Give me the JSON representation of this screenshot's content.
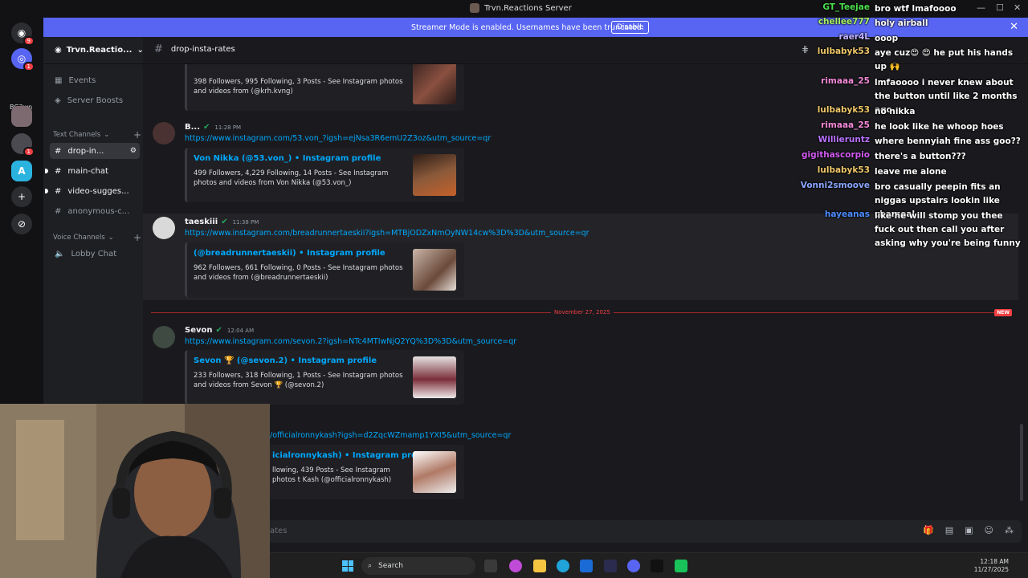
{
  "window": {
    "title": "Trvn.Reactions Server",
    "controls": [
      "—",
      "☐",
      "✕"
    ]
  },
  "banner": {
    "message": "Streamer Mode is enabled. Usernames have been truncated.",
    "disable_label": "Disable"
  },
  "rail": {
    "label": "BG3wn",
    "badges": [
      "9",
      "1",
      "1"
    ]
  },
  "guild": {
    "name": "Trvn.Reactio..."
  },
  "sidebar": {
    "events": "Events",
    "boosts": "Server Boosts",
    "text_cat": "Text Channels",
    "voice_cat": "Voice Channels",
    "channels": [
      "drop-in...",
      "main-chat",
      "video-sugges...",
      "anonymous-c..."
    ],
    "voice": [
      "Lobby Chat"
    ]
  },
  "channel": {
    "name": "drop-insta-rates"
  },
  "messages": [
    {
      "desc": "398 Followers, 995 Following, 3 Posts - See Instagram photos and videos from (@krh.kvng)"
    },
    {
      "user": "B...",
      "time": "11:28 PM",
      "link": "https://www.instagram.com/53.von_?igsh=ejNsa3R6emU2Z3oz&utm_source=qr",
      "title": "Von Nikka (@53.von_) • Instagram profile",
      "desc": "499 Followers, 4,229 Following, 14 Posts - See Instagram photos and videos from Von Nikka (@53.von_)"
    },
    {
      "user": "taeskiii",
      "time": "11:38 PM",
      "link": "https://www.instagram.com/breadrunnertaeskii?igsh=MTBjODZxNmOyNW14cw%3D%3D&utm_source=qr",
      "title": "(@breadrunnertaeskii) • Instagram profile",
      "desc": "962 Followers, 661 Following, 0 Posts - See Instagram photos and videos from (@breadrunnertaeskii)"
    },
    {
      "user": "Sevon",
      "time": "12:04 AM",
      "link": "https://www.instagram.com/sevon.2?igsh=NTc4MTIwNjQ2YQ%3D%3D&utm_source=qr",
      "title": "Sevon 🏆 (@sevon.2) • Instagram profile",
      "desc": "233 Followers, 318 Following, 1 Posts - See Instagram photos and videos from Sevon 🏆 (@sevon.2)"
    },
    {
      "link": "/officialronnykash?igsh=d2ZqcWZmamp1YXI5&utm_source=qr",
      "title": "icialronnykash) • Instagram profile",
      "desc": "llowing, 439 Posts - See Instagram photos t Kash (@officialronnykash)"
    }
  ],
  "divider": {
    "date": "November 27, 2025",
    "new": "NEW"
  },
  "composer": {
    "placeholder": "ates"
  },
  "taskbar": {
    "search": "Search",
    "time": "12:18 AM",
    "date": "11/27/2025"
  },
  "overlay_chat": [
    {
      "user": "GT_Teejae",
      "text": "bro wtf lmafoooo",
      "color": "#4be04b"
    },
    {
      "user": "chellee777",
      "text": "holy airball",
      "color": "#a7f263"
    },
    {
      "user": "raer4L",
      "text": "ooop",
      "color": "#c0b2ff"
    },
    {
      "user": "lulbabyk53",
      "text": "aye cuz😍 😍 he put his hands up 🙌",
      "color": "#f1c86a"
    },
    {
      "user": "rimaaa_25",
      "text": "lmfaoooo i never knew about the button until like 2 months ago",
      "color": "#f58ad9"
    },
    {
      "user": "lulbabyk53",
      "text": "no nikka",
      "color": "#f1c86a"
    },
    {
      "user": "rimaaa_25",
      "text": "he look like he whoop hoes",
      "color": "#f58ad9"
    },
    {
      "user": "Willieruntz",
      "text": "where bennyiah fine ass goo??",
      "color": "#b872ff"
    },
    {
      "user": "gigithascorpio",
      "text": "there's a button???",
      "color": "#d15bf0"
    },
    {
      "user": "lulbabyk53",
      "text": "leave me alone",
      "color": "#f1c86a"
    },
    {
      "user": "Vonni2smoove",
      "text": "bro casually peepin fits an niggas upstairs lookin like charcoal",
      "color": "#8aa6ff"
    },
    {
      "user": "hayeanas",
      "text": "like he will stomp you thee fuck out then call you after asking why you're being funny",
      "color": "#4d8cff"
    }
  ]
}
